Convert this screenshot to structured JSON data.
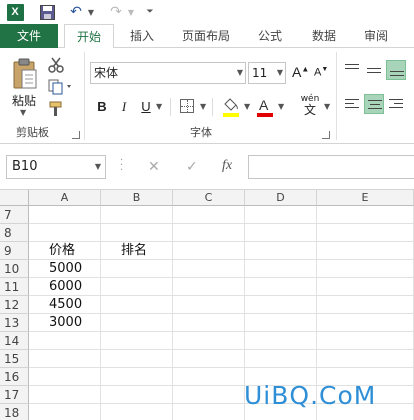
{
  "qat": {
    "app_icon_letter": "X"
  },
  "tabs": [
    "文件",
    "开始",
    "插入",
    "页面布局",
    "公式",
    "数据",
    "审阅"
  ],
  "ribbon": {
    "clipboard": {
      "paste_label": "粘贴",
      "group_label": "剪贴板"
    },
    "font": {
      "font_name": "宋体",
      "font_size": "11",
      "grow_label": "A",
      "shrink_label": "A",
      "bold_label": "B",
      "italic_label": "I",
      "underline_label": "U",
      "wen_top": "wén",
      "wen_bottom": "文",
      "group_label": "字体"
    },
    "colors": {
      "fill": "#ffff00",
      "font": "#e00000",
      "accent": "#217346",
      "align_active": "#a8d5b9"
    }
  },
  "formula_bar": {
    "name_box": "B10",
    "fx_label": "fx",
    "formula": ""
  },
  "grid": {
    "columns": [
      "A",
      "B",
      "C",
      "D",
      "E"
    ],
    "rows": [
      "7",
      "8",
      "9",
      "10",
      "11",
      "12",
      "13",
      "14",
      "15",
      "16",
      "17",
      "18"
    ],
    "cells": {
      "A9": "价格",
      "B9": "排名",
      "A10": "5000",
      "A11": "6000",
      "A12": "4500",
      "A13": "3000"
    }
  },
  "watermark": "UiBQ.CoM"
}
